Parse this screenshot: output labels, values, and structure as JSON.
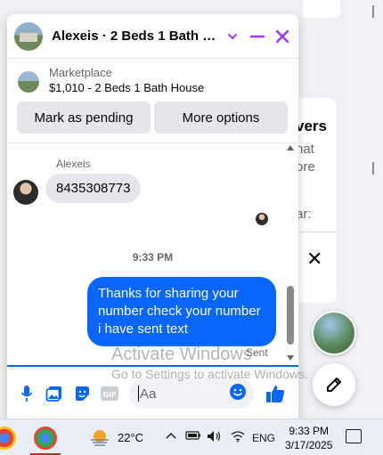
{
  "background": {
    "panel_title": "vers",
    "panel_text": "hat\nore",
    "panel_label": "ar:",
    "close_symbol": "✕"
  },
  "chat": {
    "title": "Alexeis · 2 Beds 1 Bath House",
    "listing_label": "Marketplace",
    "listing_desc": "$1,010 - 2 Beds 1 Bath House",
    "buttons": [
      "Mark as pending",
      "More options"
    ],
    "sender_name": "Alexeis",
    "incoming_message": "8435308773",
    "timestamp": "9:33 PM",
    "outgoing_message": "Thanks for sharing your number check your number i have sent text",
    "status": "Sent",
    "composer_placeholder": "Aa"
  },
  "watermark": {
    "line1": "Activate Windows",
    "line2": "Go to Settings to activate Windows."
  },
  "taskbar": {
    "temperature": "22°C",
    "language": "ENG",
    "time": "9:33 PM",
    "date": "3/17/2025"
  },
  "colors": {
    "accent": "#0866ff",
    "header_icons": "#a033ff",
    "bubble_in": "#e4e6eb"
  }
}
